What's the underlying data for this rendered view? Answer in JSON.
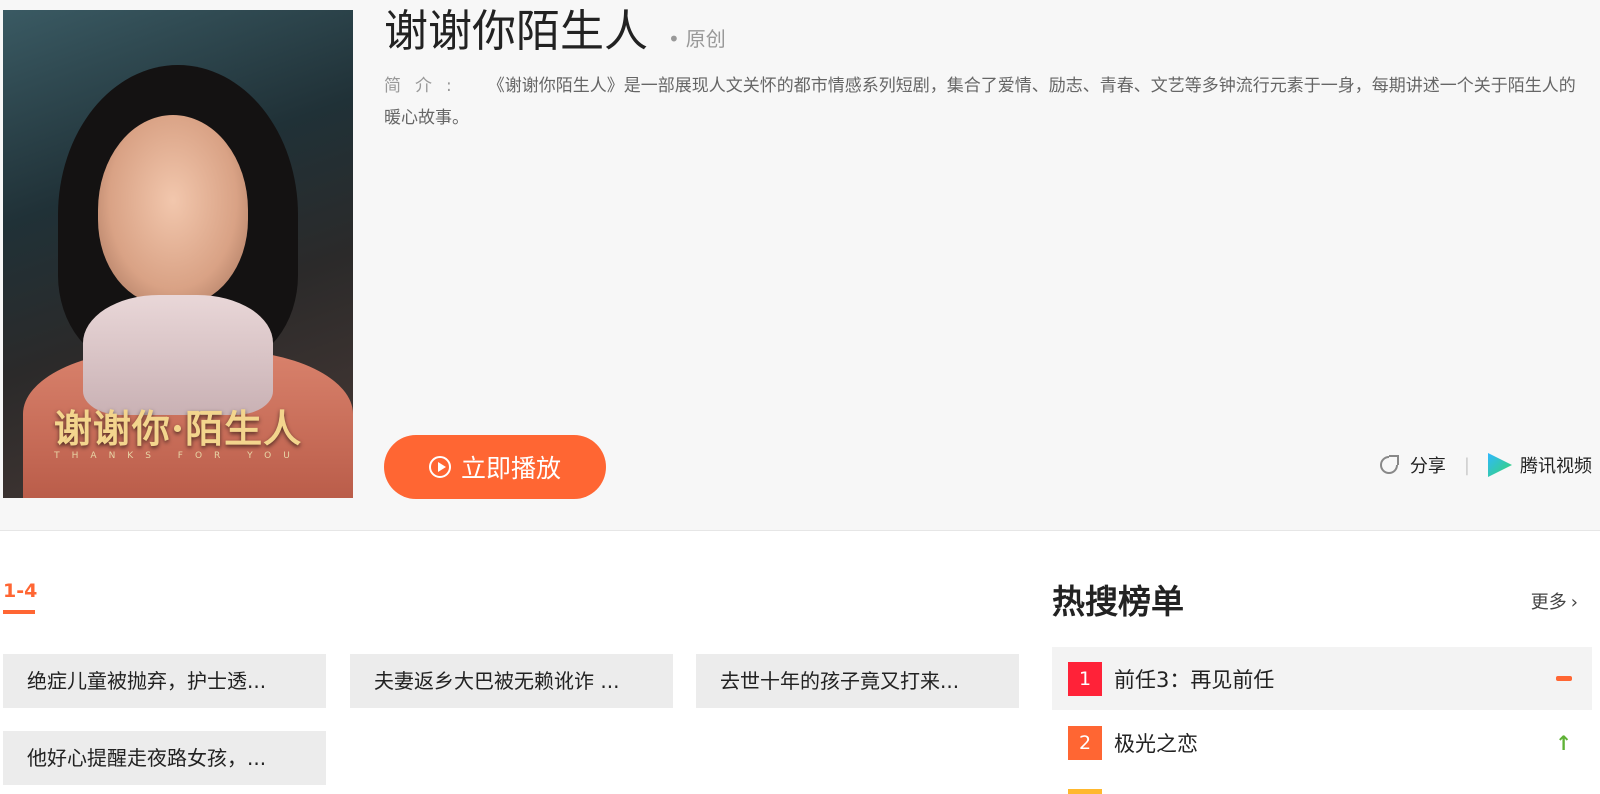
{
  "show": {
    "title": "谢谢你陌生人",
    "tag": "原创",
    "intro_label": "简介:",
    "intro_text": "《谢谢你陌生人》是一部展现人文关怀的都市情感系列短剧，集合了爱情、励志、青春、文艺等多钟流行元素于一身，每期讲述一个关于陌生人的暖心故事。",
    "poster_title": "谢谢你·陌生人",
    "poster_subtitle": "THANKS FOR YOU",
    "play_label": "立即播放",
    "share_label": "分享",
    "platform_label": "腾讯视频"
  },
  "episodes": {
    "range_tab": "1-4",
    "items": [
      {
        "label": "绝症儿童被抛弃，护士透..."
      },
      {
        "label": "夫妻返乡大巴被无赖讹诈 ..."
      },
      {
        "label": "去世十年的孩子竟又打来..."
      },
      {
        "label": "他好心提醒走夜路女孩，..."
      }
    ]
  },
  "hot": {
    "title": "热搜榜单",
    "more_label": "更多",
    "items": [
      {
        "rank": "1",
        "name": "前任3：再见前任",
        "trend": "flat",
        "rank_color": "#ff2238"
      },
      {
        "rank": "2",
        "name": "极光之恋",
        "trend": "up",
        "rank_color": "#ff6633"
      }
    ],
    "rank3_color": "#ffb82e"
  },
  "colors": {
    "accent": "#ff6633",
    "up": "#5fb236"
  }
}
